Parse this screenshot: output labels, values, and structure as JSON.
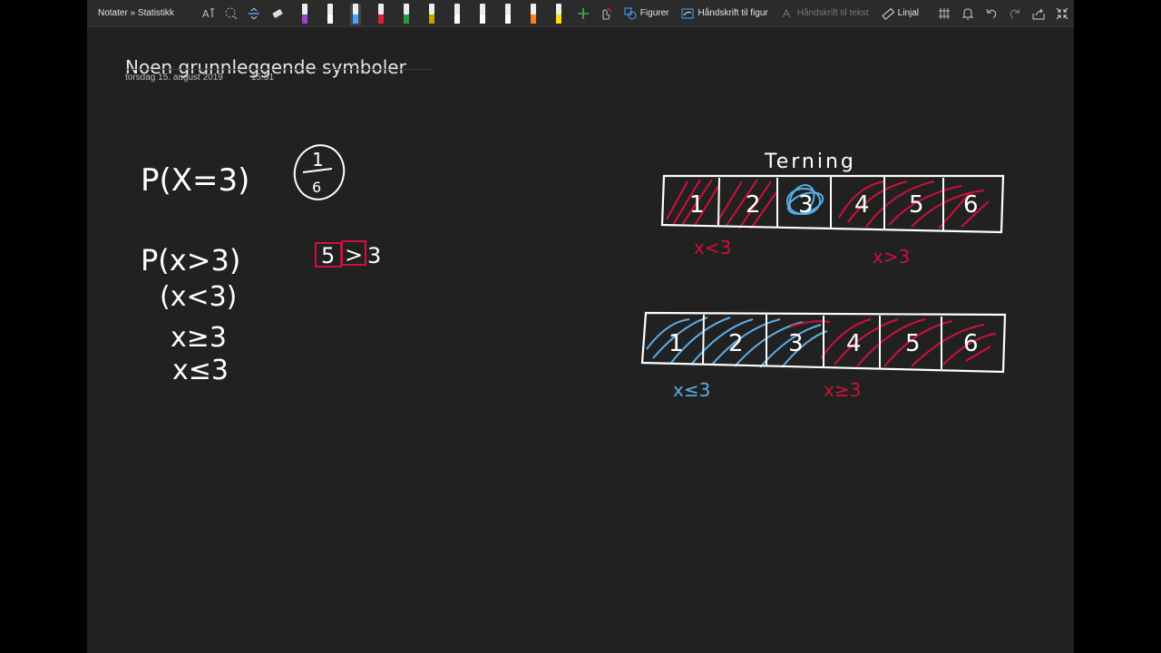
{
  "toolbar": {
    "breadcrumb": "Notater » Statistikk",
    "shapes_label": "Figurer",
    "ink_to_shape_label": "Håndskrift til figur",
    "ink_to_text_label": "Håndskrift til tekst",
    "ruler_label": "Linjal",
    "pens": [
      {
        "color": "#a040d0"
      },
      {
        "color": "#ffffff"
      },
      {
        "color": "#4aa3ff",
        "selected": true
      },
      {
        "color": "#e02030"
      },
      {
        "color": "#20a040"
      },
      {
        "color": "#c8a000"
      },
      {
        "color": "#ffffff"
      },
      {
        "color": "#ffffff"
      },
      {
        "color": "#ffffff"
      },
      {
        "color": "#ff8020"
      },
      {
        "color": "#ffe000"
      }
    ]
  },
  "page": {
    "title": "Noen grunnleggende symboler",
    "date": "torsdag 15. august 2019",
    "time": "15:51"
  },
  "ink": {
    "expr1": "P(X=3)",
    "fraction_num": "1",
    "fraction_den": "6",
    "expr2": "P(x>3)",
    "expr3": "(x<3)",
    "expr4": "x≥3",
    "expr5": "x≤3",
    "example_left": "5",
    "example_op": ">",
    "example_right": "3",
    "die_title": "Terning",
    "die_faces": [
      "1",
      "2",
      "3",
      "4",
      "5",
      "6"
    ],
    "row1_left_label": "x<3",
    "row1_right_label": "x>3",
    "row2_left_label": "x≤3",
    "row2_right_label": "x≥3",
    "colors": {
      "ink": "#ffffff",
      "red": "#d0103a",
      "blue": "#5aaee8"
    }
  }
}
